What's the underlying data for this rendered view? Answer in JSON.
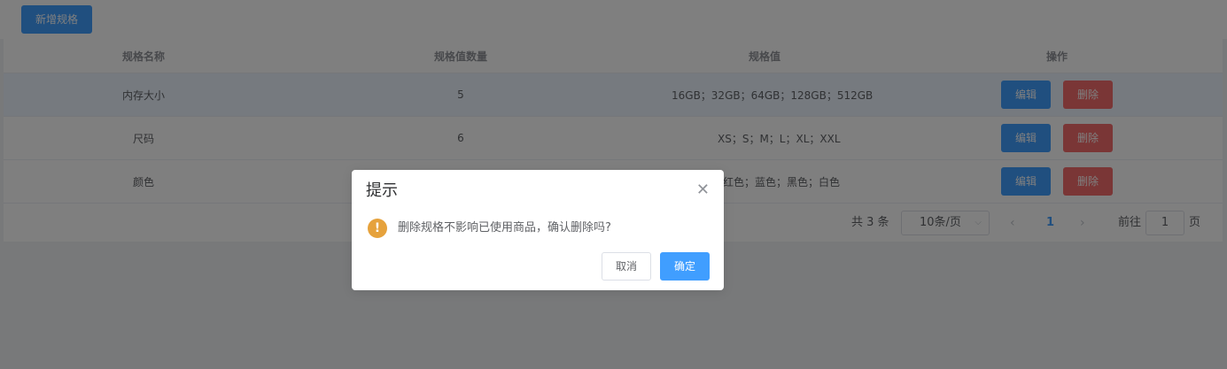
{
  "toolbar": {
    "add_label": "新增规格"
  },
  "table": {
    "headers": [
      "规格名称",
      "规格值数量",
      "规格值",
      "操作"
    ],
    "rows": [
      {
        "name": "内存大小",
        "count": "5",
        "values": "16GB；32GB；64GB；128GB；512GB",
        "edit": "编辑",
        "delete": "删除"
      },
      {
        "name": "尺码",
        "count": "6",
        "values": "XS；S；M；L；XL；XXL",
        "edit": "编辑",
        "delete": "删除"
      },
      {
        "name": "颜色",
        "count": "",
        "values": "红色；蓝色；黑色；白色",
        "edit": "编辑",
        "delete": "删除"
      }
    ]
  },
  "pagination": {
    "total": "共 3 条",
    "page_size": "10条/页",
    "current_page": "1",
    "goto_prefix": "前往",
    "goto_value": "1",
    "goto_suffix": "页"
  },
  "dialog": {
    "title": "提示",
    "message": "删除规格不影响已使用商品，确认删除吗?",
    "cancel": "取消",
    "confirm": "确定"
  },
  "icons": {
    "close": "close-icon",
    "warning": "warning-icon",
    "prev": "chevron-left-icon",
    "next": "chevron-right-icon",
    "select_arrow": "chevron-down-icon"
  },
  "colors": {
    "primary": "#409eff",
    "danger": "#f56c6c",
    "warning": "#e6a23c"
  }
}
